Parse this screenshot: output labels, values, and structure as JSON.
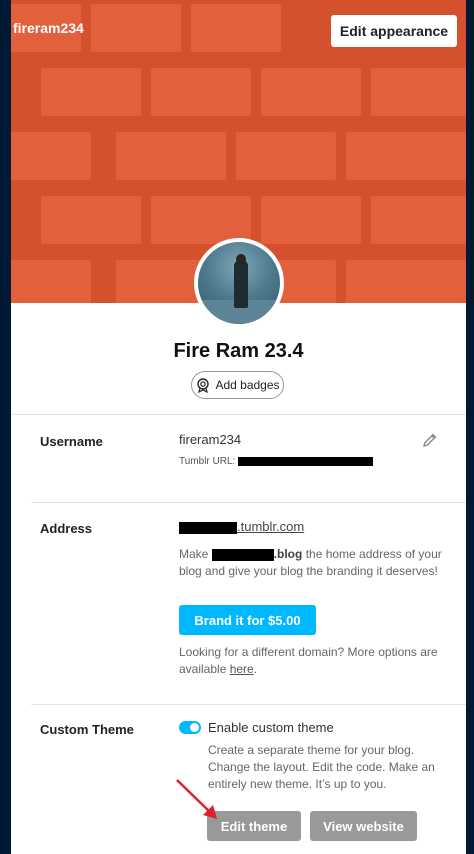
{
  "header": {
    "blog_name": "fireram234",
    "edit_appearance_label": "Edit appearance",
    "brand_color": "#d5512d"
  },
  "profile": {
    "title": "Fire Ram 23.4",
    "add_badges_label": "Add badges"
  },
  "username": {
    "label": "Username",
    "value": "fireram234",
    "url_label": "Tumblr URL:"
  },
  "address": {
    "label": "Address",
    "domain_suffix": ".tumblr.com",
    "make_prefix": "Make",
    "make_blog": ".blog",
    "make_rest": " the home address of your blog and give your blog the branding it deserves!",
    "brand_button": "Brand it for $5.00",
    "more_options": "Looking for a different domain? More options are available ",
    "here_link": "here",
    "period": ".",
    "accent_color": "#00b8ff"
  },
  "custom_theme": {
    "label": "Custom Theme",
    "toggle_label": "Enable custom theme",
    "toggle_on": true,
    "description": "Create a separate theme for your blog. Change the layout. Edit the code. Make an entirely new theme. It’s up to you.",
    "edit_theme_button": "Edit theme",
    "view_website_button": "View website"
  },
  "icons": [
    "pencil-icon",
    "badge-icon",
    "red-arrow-annotation"
  ]
}
